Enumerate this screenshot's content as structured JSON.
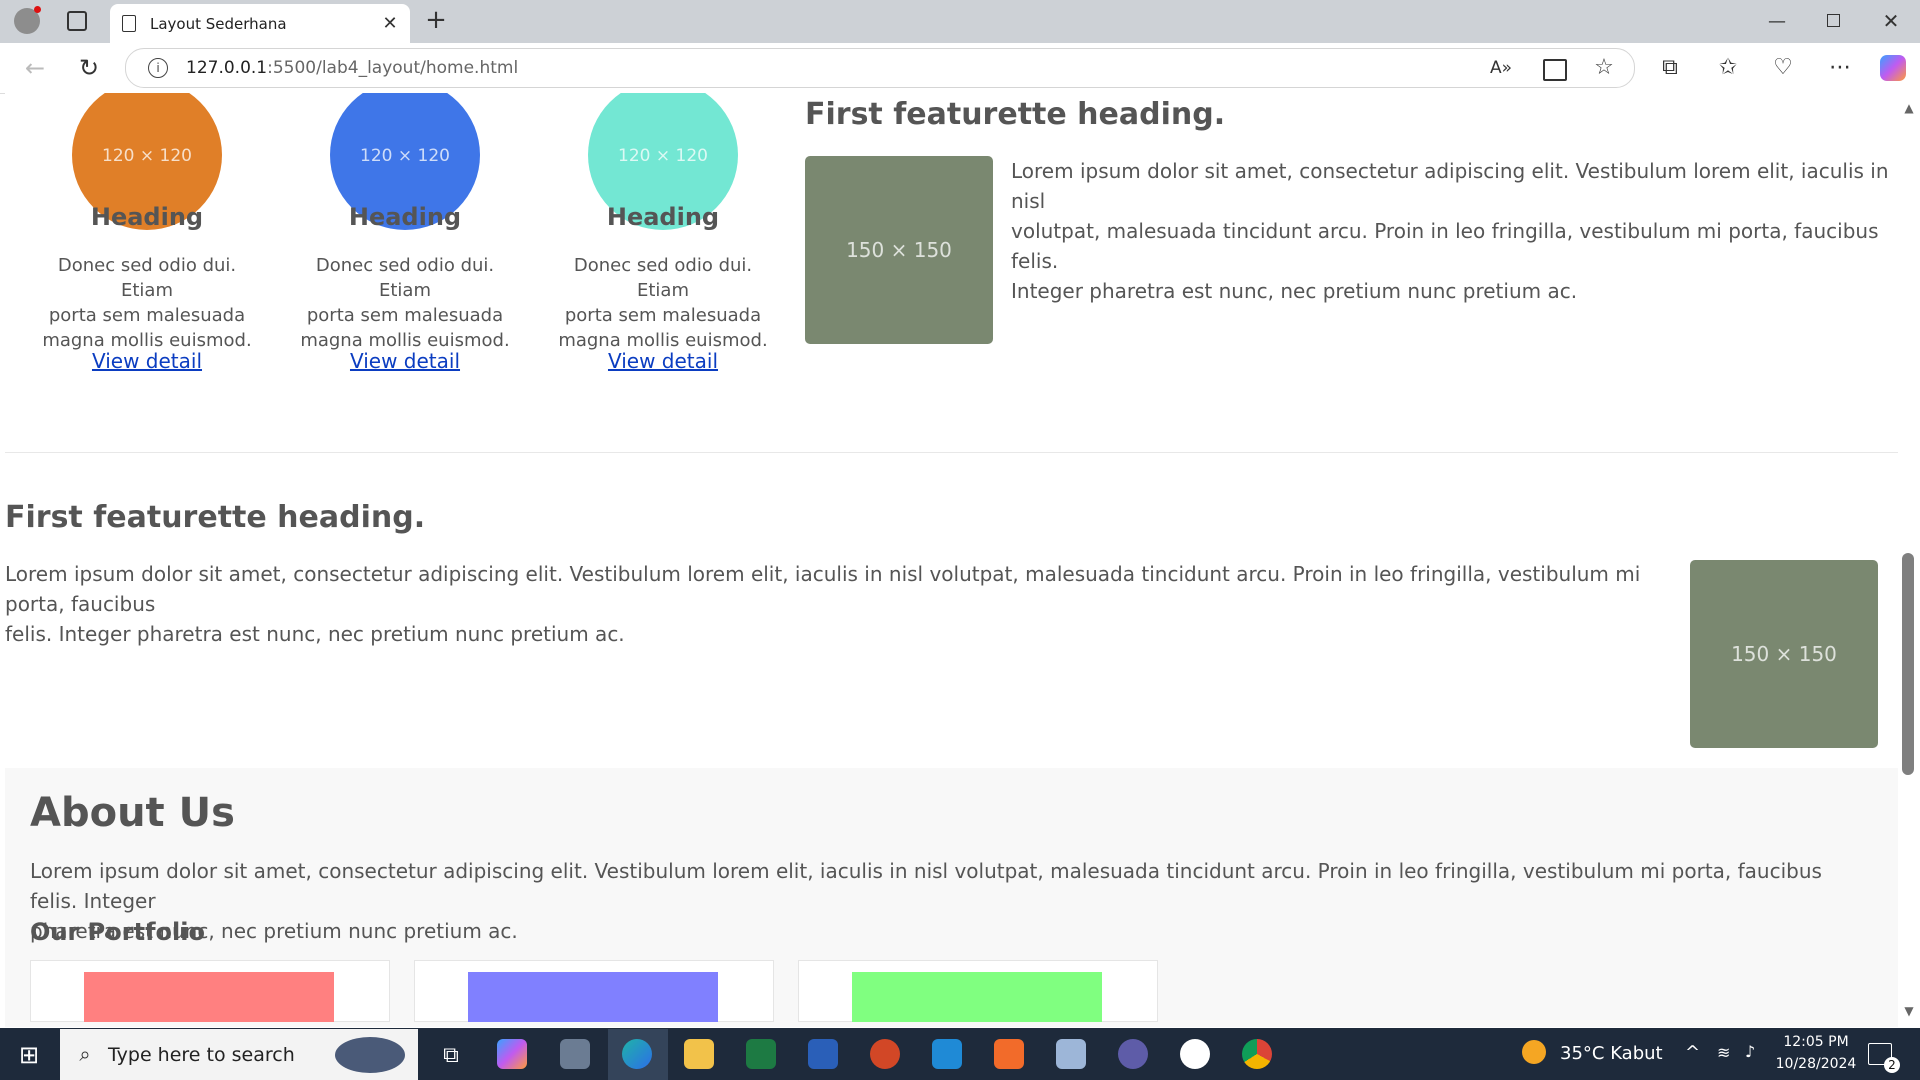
{
  "browser": {
    "tab_title": "Layout Sederhana",
    "url_host": "127.0.0.1",
    "url_path": ":5500/lab4_layout/home.html"
  },
  "columns": [
    {
      "img_label": "120 × 120",
      "color": "#e07f28",
      "heading": "Heading",
      "text_lines": [
        "Donec sed odio dui. Etiam",
        "porta sem malesuada",
        "magna mollis euismod."
      ],
      "link": "View detail"
    },
    {
      "img_label": "120 × 120",
      "color": "#3f76e8",
      "heading": "Heading",
      "text_lines": [
        "Donec sed odio dui. Etiam",
        "porta sem malesuada",
        "magna mollis euismod."
      ],
      "link": "View detail"
    },
    {
      "img_label": "120 × 120",
      "color": "#73e7d3",
      "heading": "Heading",
      "text_lines": [
        "Donec sed odio dui. Etiam",
        "porta sem malesuada",
        "magna mollis euismod."
      ],
      "link": "View detail"
    }
  ],
  "featurette_right": {
    "heading": "First featurette heading.",
    "img_label": "150 × 150",
    "text_lines": [
      "Lorem ipsum dolor sit amet, consectetur adipiscing elit. Vestibulum lorem elit, iaculis in nisl",
      "volutpat, malesuada tincidunt arcu. Proin in leo fringilla, vestibulum mi porta, faucibus felis.",
      "Integer pharetra est nunc, nec pretium nunc pretium ac."
    ]
  },
  "featurette_left": {
    "heading": "First featurette heading.",
    "img_label": "150 × 150",
    "text_lines": [
      "Lorem ipsum dolor sit amet, consectetur adipiscing elit. Vestibulum lorem elit, iaculis in nisl volutpat, malesuada tincidunt arcu. Proin in leo fringilla, vestibulum mi porta, faucibus",
      "felis. Integer pharetra est nunc, nec pretium nunc pretium ac."
    ]
  },
  "about": {
    "heading": "About Us",
    "text_lines": [
      "Lorem ipsum dolor sit amet, consectetur adipiscing elit. Vestibulum lorem elit, iaculis in nisl volutpat, malesuada tincidunt arcu. Proin in leo fringilla, vestibulum mi porta, faucibus felis. Integer",
      "pharetra est nunc, nec pretium nunc pretium ac."
    ],
    "portfolio_heading": "Our Portfolio",
    "portfolio_colors": [
      "#ff8080",
      "#8080ff",
      "#80ff80"
    ]
  },
  "taskbar": {
    "search_placeholder": "Type here to search",
    "weather": "35°C  Kabut",
    "time": "12:05 PM",
    "date": "10/28/2024",
    "notifications": "2"
  }
}
